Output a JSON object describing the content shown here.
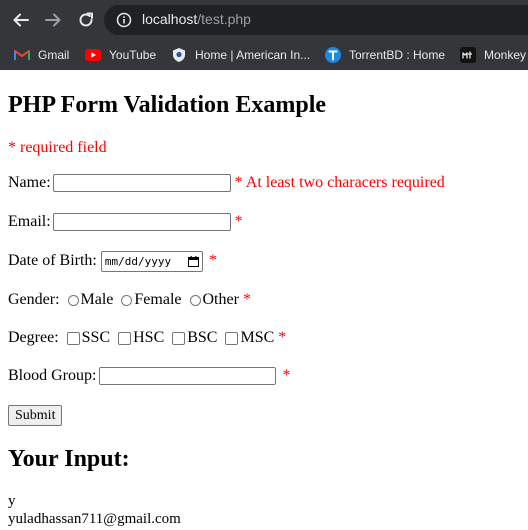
{
  "browser": {
    "url_host": "localhost",
    "url_path": "/test.php",
    "bookmarks": [
      {
        "label": "Gmail",
        "icon": "gmail-icon"
      },
      {
        "label": "YouTube",
        "icon": "youtube-icon"
      },
      {
        "label": "Home | American In...",
        "icon": "american-institute-icon"
      },
      {
        "label": "TorrentBD : Home",
        "icon": "torrentbd-icon"
      },
      {
        "label": "Monkey",
        "icon": "monkeytype-icon"
      }
    ]
  },
  "page": {
    "title": "PHP Form Validation Example",
    "required_note": "* required field",
    "name": {
      "label": "Name:",
      "value": "",
      "error": "* At least two characers required"
    },
    "email": {
      "label": "Email:",
      "value": "",
      "error": "*"
    },
    "dob": {
      "label": "Date of Birth:",
      "placeholder": "mm/dd/yyyy",
      "error": "*"
    },
    "gender": {
      "label": "Gender:",
      "options": [
        "Male",
        "Female",
        "Other"
      ],
      "error": "*"
    },
    "degree": {
      "label": "Degree:",
      "options": [
        "SSC",
        "HSC",
        "BSC",
        "MSC"
      ],
      "error": "*"
    },
    "blood": {
      "label": "Blood Group:",
      "value": "",
      "error": "*"
    },
    "submit_label": "Submit",
    "output_title": "Your Input:",
    "output_lines": [
      "y",
      "yuladhassan711@gmail.com"
    ]
  },
  "colors": {
    "error": "#ff0000",
    "chrome_bg": "#35363a",
    "omnibox_bg": "#202124"
  }
}
